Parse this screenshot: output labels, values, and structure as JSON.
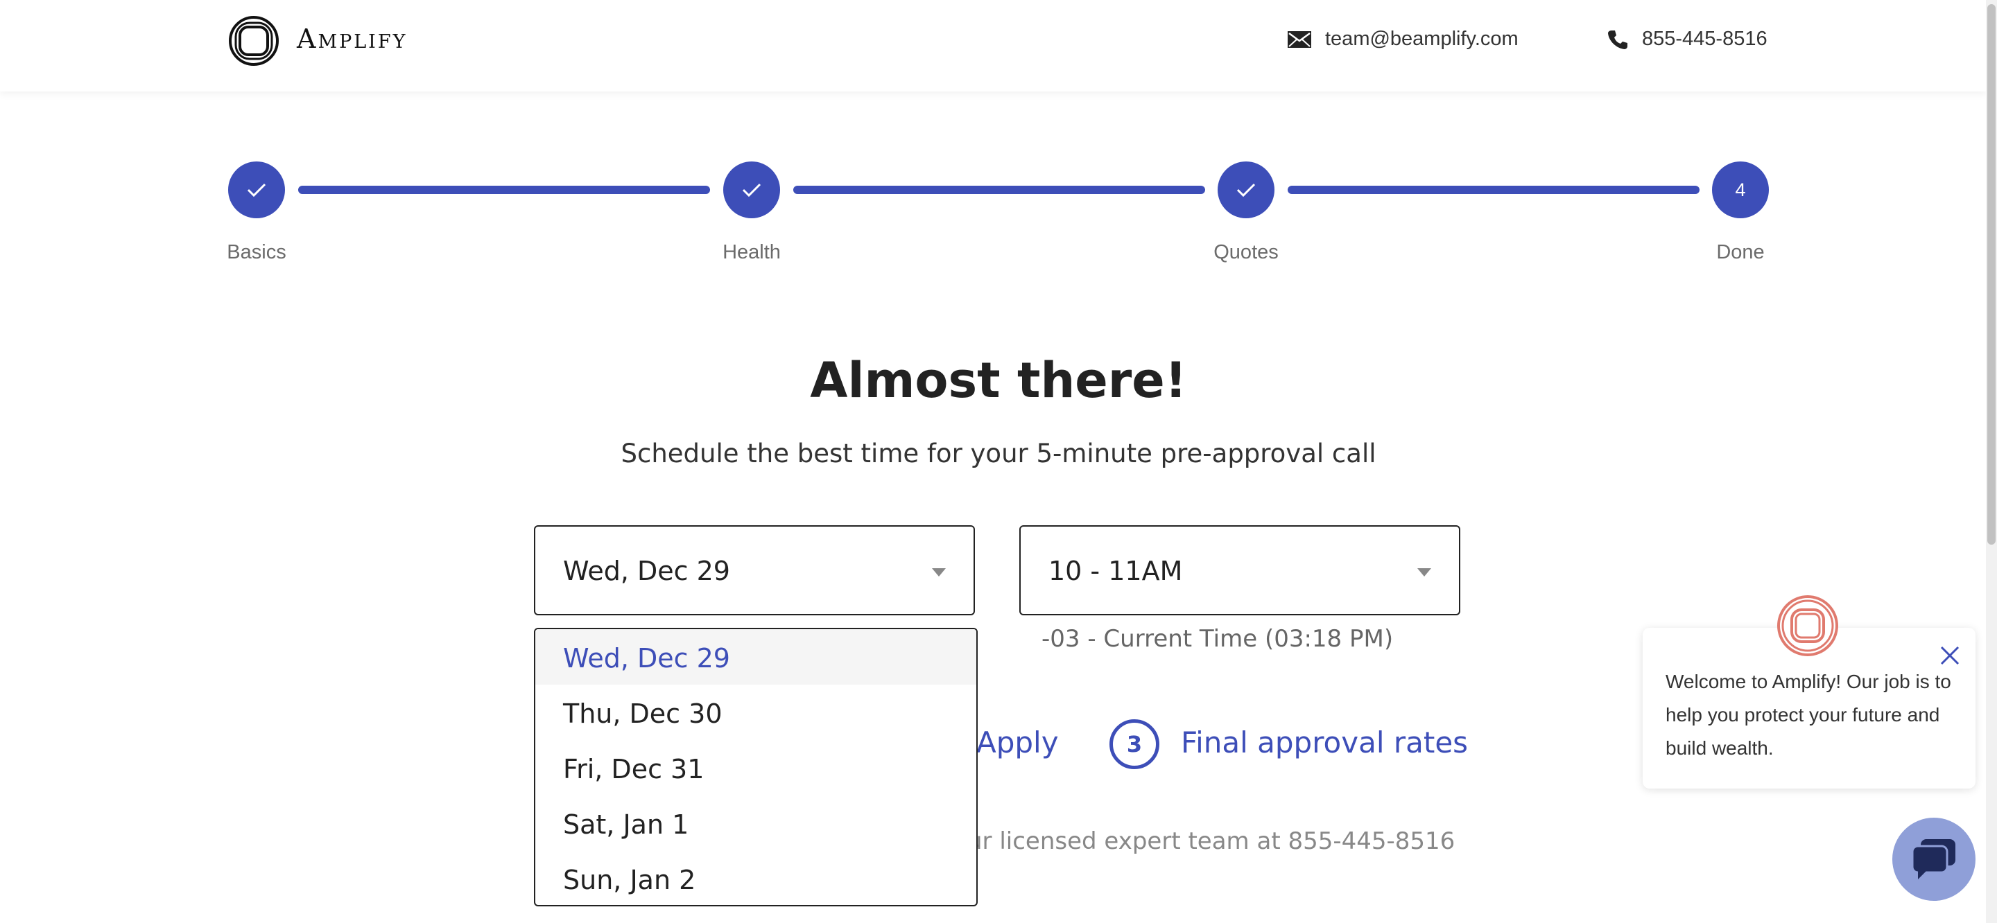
{
  "header": {
    "brand": "Amplify",
    "email": "team@beamplify.com",
    "phone": "855-445-8516",
    "email_icon": "envelope-icon",
    "phone_icon": "phone-icon"
  },
  "stepper": {
    "steps": [
      {
        "label": "Basics",
        "state": "complete",
        "icon": "check-icon"
      },
      {
        "label": "Health",
        "state": "complete",
        "icon": "check-icon"
      },
      {
        "label": "Quotes",
        "state": "complete",
        "icon": "check-icon"
      },
      {
        "label": "Done",
        "state": "current",
        "number": "4"
      }
    ]
  },
  "main": {
    "title": "Almost there!",
    "subtitle": "Schedule the best time for your 5-minute pre-approval call",
    "date_select": {
      "value": "Wed, Dec 29"
    },
    "time_select": {
      "value": "10 - 11AM"
    },
    "timezone_note": "-03 - Current Time (03:18 PM)",
    "process": {
      "apply_label": "Apply",
      "step3_number": "3",
      "step3_label": "Final approval rates"
    },
    "expert_text": "ur licensed expert team at 855-445-8516"
  },
  "dropdown": {
    "options": [
      "Wed, Dec 29",
      "Thu, Dec 30",
      "Fri, Dec 31",
      "Sat, Jan 1",
      "Sun, Jan 2"
    ],
    "selected_index": 0
  },
  "chat": {
    "message": "Welcome to Amplify! Our job is to help you protect your future and build wealth.",
    "logo_icon": "amplify-logo-icon",
    "close_icon": "close-icon",
    "launcher_icon": "chat-bubble-icon"
  },
  "colors": {
    "primary": "#3d4eb8",
    "chat_launcher": "#8f9fd8",
    "chat_logo": "#e07a6e"
  }
}
